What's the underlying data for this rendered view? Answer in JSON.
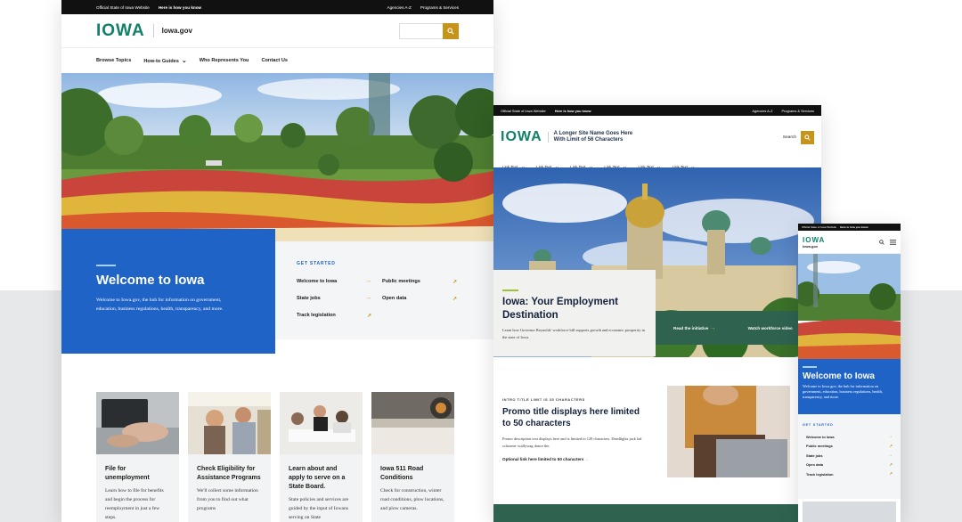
{
  "desktop": {
    "topbar": {
      "official": "Official State of Iowa Website",
      "how": "Here is how you know",
      "agencies": "Agencies A-Z",
      "programs": "Programs & Services"
    },
    "logo": "IOWA",
    "site_name": "Iowa.gov",
    "nav": [
      "Browse Topics",
      "How-to Guides",
      "Who Represents You",
      "Contact Us"
    ],
    "welcome": {
      "title": "Welcome to Iowa",
      "body": "Welcome to Iowa.gov, the hub for information on government, education, business regulations, health, transparency, and more."
    },
    "get_started": {
      "heading": "GET STARTED",
      "links": [
        "Welcome to Iowa",
        "Public meetings",
        "State jobs",
        "Open data",
        "Track legislation"
      ]
    },
    "cards": [
      {
        "title": "File for unemployment",
        "body": "Learn how to file for benefits and begin the process for reemployment in just a few steps."
      },
      {
        "title": "Check Eligibility for Assistance Programs",
        "body": "We'll collect some information from you to find out what programs"
      },
      {
        "title": "Learn about and apply to serve on a State Board.",
        "body": "State policies and services are guided by the input of Iowans serving on State"
      },
      {
        "title": "Iowa 511 Road Conditions",
        "body": "Check for construction, winter road conditions, plow locations, and plow cameras."
      }
    ]
  },
  "tablet": {
    "topbar": {
      "official": "Official State of Iowa Website",
      "how": "Here is how you know",
      "agencies": "Agencies A-Z",
      "programs": "Programs & Services"
    },
    "logo": "IOWA",
    "site_name_line1": "A Longer Site Name Goes Here",
    "site_name_line2": "With Limit of 56 Characters",
    "search_label": "Search",
    "nav": [
      "Link Text",
      "Link Text",
      "Link Text",
      "Link Text",
      "Link Text",
      "Link Text"
    ],
    "promo": {
      "title": "Iowa: Your Employment Destination",
      "body": "Learn how Governor Reynolds' workforce bill supports growth and economic prosperity in the state of Iowa."
    },
    "actions": [
      "Read the initiative",
      "Watch workforce video"
    ],
    "intro": {
      "eyebrow": "INTRO TITLE LIMIT IS 35 CHARACTERS",
      "title": "Promo title displays here limited to 50 characters",
      "body": "Promo description text displays here and is limited to 120 characters. Deadlights jack lad schooner scallywag dance the.",
      "link": "Optional link here limited to 50 characters"
    }
  },
  "mobile": {
    "topbar": {
      "official": "Official State of Iowa Website",
      "how": "Here is how you know"
    },
    "logo": "IOWA",
    "site_name": "Iowa.gov",
    "welcome": {
      "title": "Welcome to Iowa",
      "body": "Welcome to Iowa.gov, the hub for information on government, education, business regulations, health, transparency, and more."
    },
    "get_started": {
      "heading": "GET STARTED",
      "links": [
        "Welcome to Iowa",
        "Public meetings",
        "State jobs",
        "Open data",
        "Track legislation"
      ]
    }
  },
  "colors": {
    "brand_green": "#12806a",
    "gold": "#c7941b",
    "blue": "#1f63c7",
    "dark_green": "#2f6350"
  }
}
